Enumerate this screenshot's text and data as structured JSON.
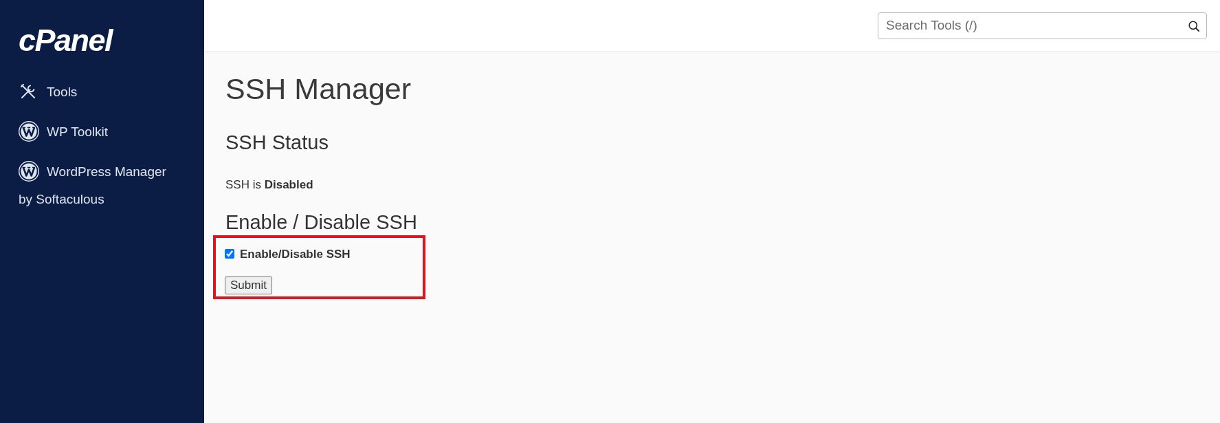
{
  "sidebar": {
    "logo": "cPanel",
    "items": [
      {
        "kind": "tools",
        "label": "Tools"
      },
      {
        "kind": "wordpress",
        "label": "WP Toolkit"
      },
      {
        "kind": "wordpress",
        "label": "WordPress Manager by Softaculous"
      }
    ]
  },
  "header": {
    "search": {
      "placeholder": "Search Tools (/)"
    }
  },
  "page": {
    "title": "SSH Manager",
    "status_heading": "SSH Status",
    "status_text": "SSH is **Disabled**",
    "toggle_heading": "Enable / Disable SSH",
    "form": {
      "highlighted": true,
      "checkbox": {
        "label": "Enable/Disable SSH",
        "checked": true
      },
      "button": "Submit"
    }
  }
}
